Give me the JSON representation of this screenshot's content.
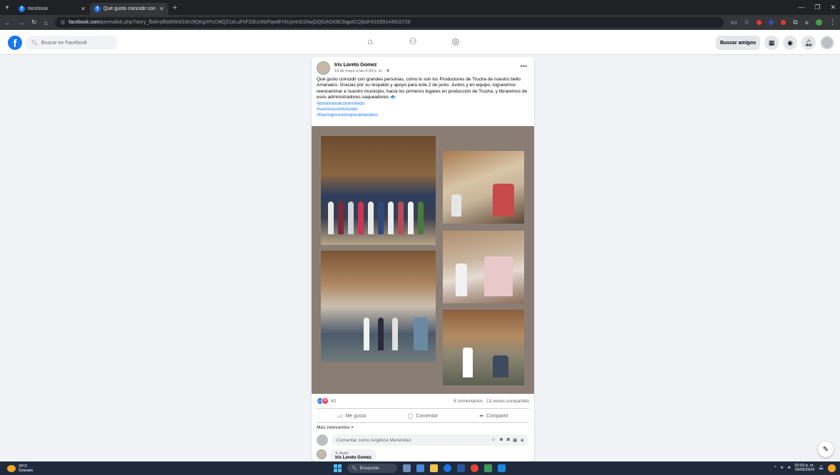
{
  "browser": {
    "tabs": [
      {
        "title": "facebook",
        "active": false
      },
      {
        "title": "Qué gusto coincidir con grand",
        "active": true
      }
    ],
    "url_host": "facebook.com",
    "url_path": "/permalink.php?story_fbid=pfbid0Wsf18iU9QKgXPsCMQZ1eLuFkFZdUcMzFqwiBYkUyvtnD2AwjDQGAGK8C9qpACQ&id=61559144915726"
  },
  "facebook": {
    "search_placeholder": "Buscar en Facebook",
    "buscar_amigos": "Buscar amigos"
  },
  "post": {
    "author": "Iris Loreto Gomez",
    "date": "19 de mayo a las 6:34 p. m. ·",
    "text": "Qué gusto coincidir con grandes personas, como lo son los Productores de Trucha de nuestro bello Amanalco. Gracias por su respaldo y apoyo para este 2 de junio. Juntos y en equipo, lograremos reencaminar a nuestro municipio, hacia los primeros lugares en producción de Trucha, y libraremos de esos administradores saqueadores 🐟",
    "hashtags": [
      "#poramanalcosinmiedo",
      "#vamosconirisloreto",
      "#fuerzaycorazonporamanalco"
    ],
    "reaction_count": "82",
    "comments": "8 comentarios",
    "shares": "13 veces compartido",
    "like_label": "Me gusta",
    "comment_label": "Comentar",
    "share_label": "Compartir",
    "sort_label": "Más relevantes ▾",
    "comment_placeholder": "Comentar como Angélica Menéndez",
    "reply_badge": "✎ Autor",
    "reply_author": "Iris Loreto Gomez"
  },
  "taskbar": {
    "temp": "29°C",
    "weather": "Soleado",
    "search_label": "Búsqueda",
    "time": "02:03 p. m.",
    "date": "29/05/2024"
  }
}
